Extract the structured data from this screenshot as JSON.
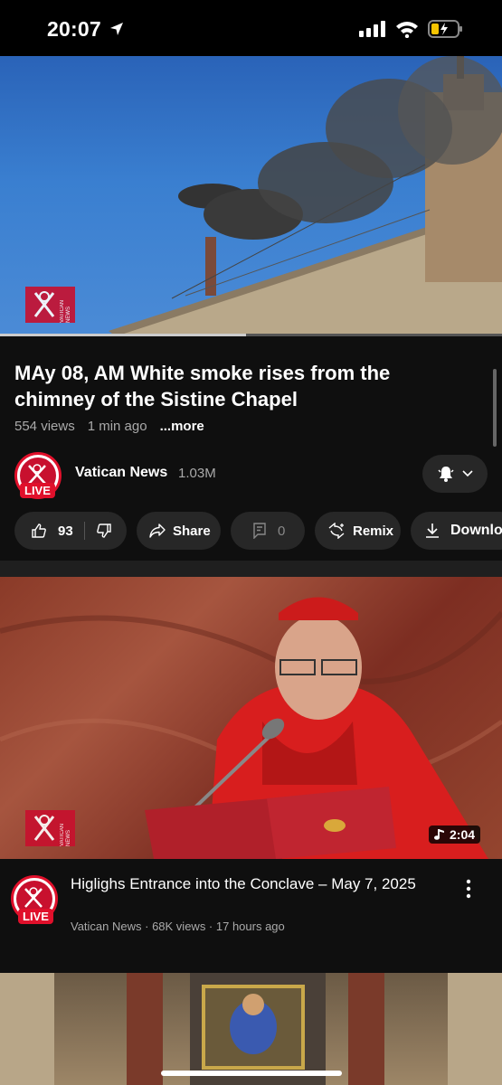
{
  "status_bar": {
    "time": "20:07"
  },
  "video": {
    "title": "MAy 08, AM White smoke rises from the chimney of the Sistine Chapel",
    "views": "554 views",
    "age": "1 min ago",
    "more_label": "...more",
    "progress_fraction": 0.49,
    "logo_text": "VATICAN NEWS"
  },
  "channel": {
    "name": "Vatican News",
    "subscribers": "1.03M",
    "live_label": "LIVE"
  },
  "actions": {
    "like_count": "93",
    "share_label": "Share",
    "comments_count": "0",
    "remix_label": "Remix",
    "download_label": "Downlo"
  },
  "feed": [
    {
      "title": "Higlighs Entrance into the Conclave – May 7, 2025",
      "meta": "Vatican News · 68K views · 17 hours ago",
      "duration": "2:04",
      "live_label": "LIVE",
      "logo_text": "VATICAN NEWS"
    }
  ]
}
